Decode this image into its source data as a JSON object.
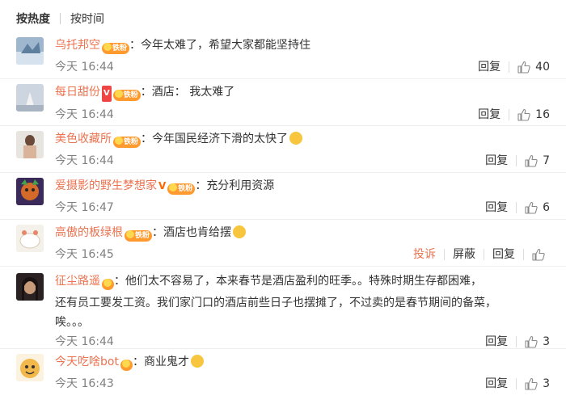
{
  "tabs": [
    {
      "label": "按热度",
      "active": true
    },
    {
      "label": "按时间",
      "active": false
    }
  ],
  "fan_badge_text": "铁粉",
  "actions": {
    "reply": "回复",
    "report": "投诉",
    "block": "屏蔽"
  },
  "comments": [
    {
      "user": "乌托邦空",
      "text": "今年太难了，希望大家都能坚持住",
      "time": "今天 16:44",
      "likes": "40"
    },
    {
      "user": "每日甜份",
      "text": "酒店：  我太难了",
      "time": "今天 16:44",
      "likes": "16"
    },
    {
      "user": "美色收藏所",
      "text": "今年国民经济下滑的太快了",
      "time": "今天 16:44",
      "likes": "7"
    },
    {
      "user": "爱摄影的野生梦想家",
      "text": "充分利用资源",
      "time": "今天 16:47",
      "likes": "6"
    },
    {
      "user": "高傲的板绿根",
      "text": "酒店也肯给摆",
      "time": "今天 16:45",
      "likes": ""
    },
    {
      "user": "征尘路遥",
      "text": "他们太不容易了，本来春节是酒店盈利的旺季。。特殊时期生存都困难，",
      "text2": "还有员工要发工资。我们家门口的酒店前些日子也摆摊了，不过卖的是春节期间的备菜，",
      "text3": "唉。。。",
      "time": "今天 16:44",
      "likes": "3"
    },
    {
      "user": "今天吃啥bot",
      "text": "商业鬼才",
      "time": "今天 16:43",
      "likes": "3"
    }
  ]
}
